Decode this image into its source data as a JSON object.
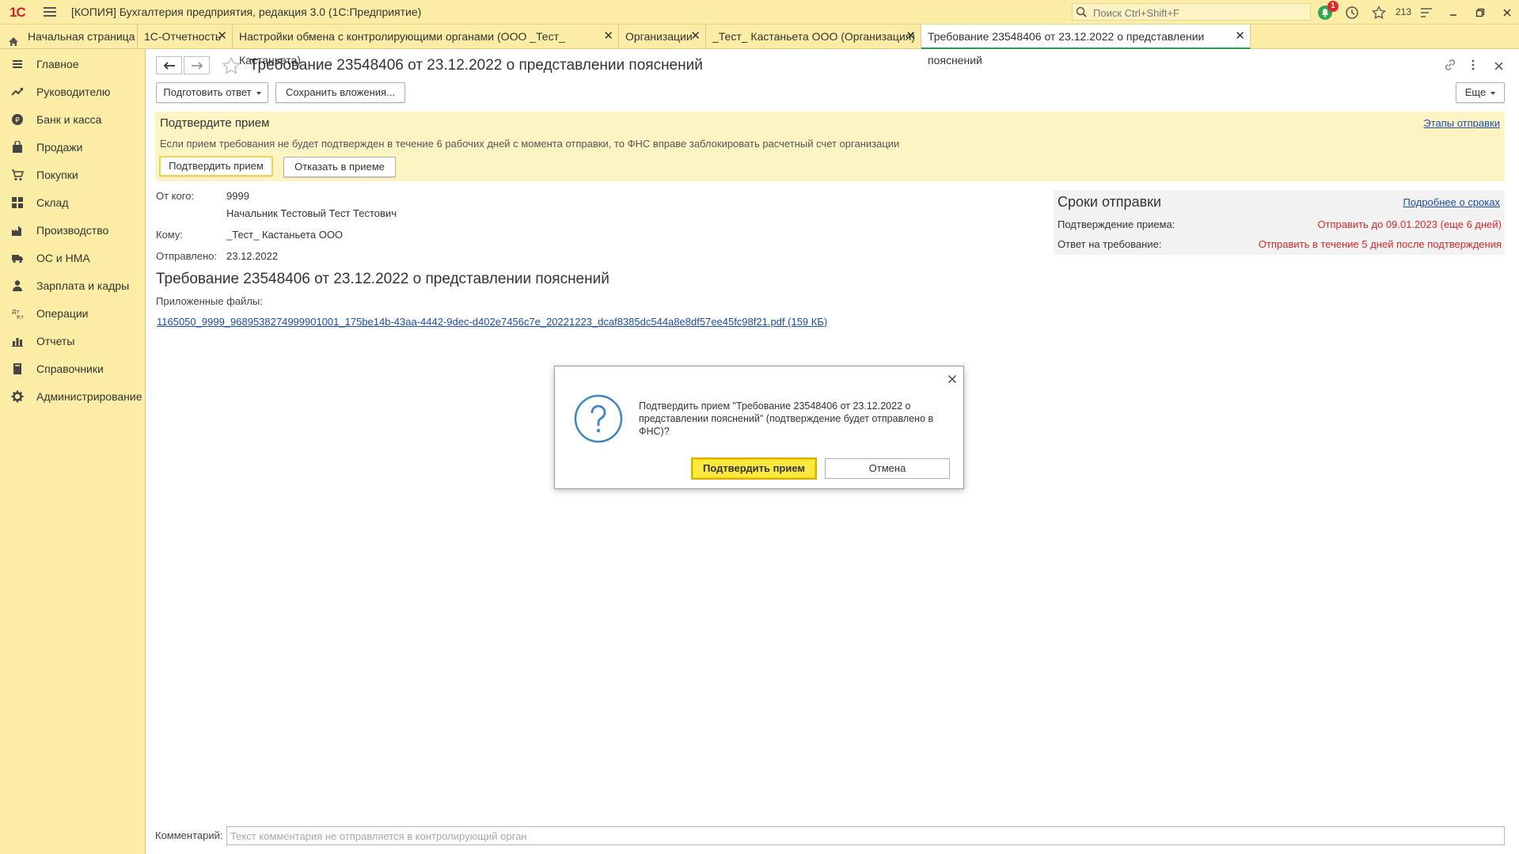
{
  "window": {
    "logo": "1С",
    "title": "[КОПИЯ] Бухгалтерия предприятия, редакция 3.0  (1С:Предприятие)",
    "search_placeholder": "Поиск Ctrl+Shift+F",
    "notification_count": "1",
    "favorites_count": "213"
  },
  "tabs": {
    "home": "Начальная страница",
    "reporting": "1С-Отчетность",
    "exchange_settings": "Настройки обмена с контролирующими органами (ООО _Тест_ Кастаньета)",
    "organizations": "Организации",
    "org_card": "_Тест_ Кастаньета ООО (Организация)",
    "requirement": "Требование 23548406 от 23.12.2022 о представлении пояснений"
  },
  "sidebar": {
    "items": [
      {
        "label": "Главное",
        "icon": "menu-icon"
      },
      {
        "label": "Руководителю",
        "icon": "trend-icon"
      },
      {
        "label": "Банк и касса",
        "icon": "coin-icon"
      },
      {
        "label": "Продажи",
        "icon": "bag-icon"
      },
      {
        "label": "Покупки",
        "icon": "cart-icon"
      },
      {
        "label": "Склад",
        "icon": "grid-icon"
      },
      {
        "label": "Производство",
        "icon": "factory-icon"
      },
      {
        "label": "ОС и НМА",
        "icon": "truck-icon"
      },
      {
        "label": "Зарплата и кадры",
        "icon": "person-icon"
      },
      {
        "label": "Операции",
        "icon": "dt-kt-icon"
      },
      {
        "label": "Отчеты",
        "icon": "bar-chart-icon"
      },
      {
        "label": "Справочники",
        "icon": "book-icon"
      },
      {
        "label": "Администрирование",
        "icon": "gear-icon"
      }
    ]
  },
  "document": {
    "title": "Требование 23548406 от 23.12.2022 о представлении пояснений",
    "toolbar": {
      "prepare_answer": "Подготовить ответ",
      "save_attachments": "Сохранить вложения...",
      "more": "Еще"
    },
    "confirm_panel": {
      "title": "Подтвердите прием",
      "stages_link": "Этапы отправки",
      "text": "Если прием требования не будет подтвержден в течение 6 рабочих дней с момента отправки, то ФНС вправе заблокировать расчетный счет организации",
      "confirm_button": "Подтвердить прием",
      "reject_button": "Отказать в приеме"
    },
    "fields": {
      "from_label": "От кого:",
      "from_code": "9999",
      "from_person": "Начальник Тестовый Тест Тестович",
      "to_label": "Кому:",
      "to_value": "_Тест_ Кастаньета ООО",
      "sent_label": "Отправлено:",
      "sent_value": "23.12.2022"
    },
    "heading": "Требование 23548406 от 23.12.2022 о представлении пояснений",
    "attachments_label": "Приложенные файлы:",
    "attachment_file": "1165050_9999_9689538274999901001_175be14b-43aa-4442-9dec-d402e7456c7e_20221223_dcaf8385dc544a8e8df57ee45fc98f21.pdf (159 КБ)",
    "deadlines": {
      "title": "Сроки отправки",
      "details_link": "Подробнее о сроках",
      "rows": [
        {
          "label": "Подтверждение приема:",
          "value": "Отправить до 09.01.2023 (еще 6 дней)"
        },
        {
          "label": "Ответ на требование:",
          "value": "Отправить в течение 5 дней после подтверждения"
        }
      ]
    },
    "comment": {
      "label": "Комментарий:",
      "placeholder": "Текст комментария не отправляется в контролирующий орган",
      "value": ""
    }
  },
  "dialog": {
    "message": "Подтвердить прием \"Требование 23548406 от 23.12.2022 о представлении пояснений\" (подтверждение будет отправлено в ФНС)?",
    "ok": "Подтвердить прием",
    "cancel": "Отмена"
  },
  "colors": {
    "panel_bg": "#fbeda5",
    "accent_button": "#fce83e",
    "link": "#1a4dad",
    "warning_red": "#d8282a",
    "active_tab_underline": "#2a9a50"
  }
}
